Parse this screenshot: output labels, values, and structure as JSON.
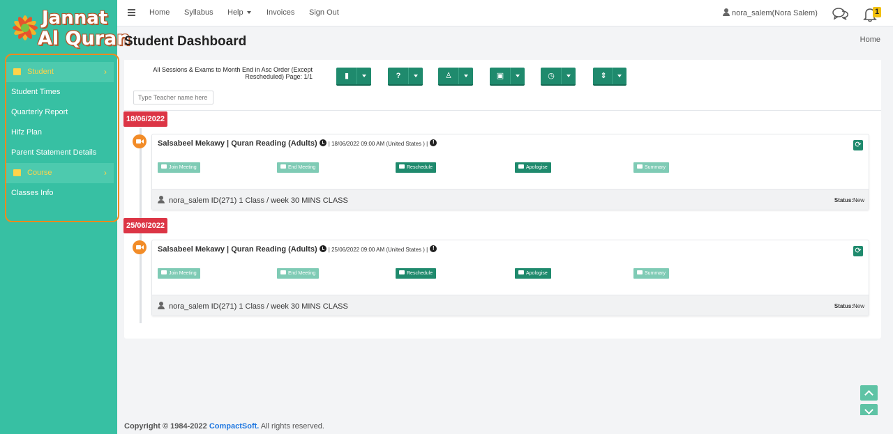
{
  "brand": {
    "line1": "Jannat",
    "line2": "Al Quran"
  },
  "sidebar": {
    "items": [
      {
        "label": "Student",
        "type": "group",
        "icon": "users-icon"
      },
      {
        "label": "Student Times",
        "type": "link"
      },
      {
        "label": "Quarterly Report",
        "type": "link"
      },
      {
        "label": "Hifz Plan",
        "type": "link"
      },
      {
        "label": "Parent Statement Details",
        "type": "link"
      },
      {
        "label": "Course",
        "type": "group",
        "icon": "book-icon"
      },
      {
        "label": "Classes Info",
        "type": "link"
      }
    ]
  },
  "topnav": {
    "links": [
      "Home",
      "Syllabus",
      "Help",
      "Invoices",
      "Sign Out"
    ],
    "user": "nora_salem(Nora Salem)",
    "notification_count": "1"
  },
  "page": {
    "title": "Student Dashboard",
    "breadcrumb": "Home"
  },
  "filters": {
    "summary": "All Sessions & Exams to Month End in Asc Order (Except Rescheduled) Page: 1/1",
    "teacher_placeholder": "Type Teacher name here",
    "toolbar_icons": [
      "book-icon",
      "question-icon",
      "user-icon",
      "calendar-icon",
      "clock-icon",
      "sort-icon"
    ]
  },
  "sessions": [
    {
      "date": "18/06/2022",
      "title": "Salsabeel Mekawy | Quran Reading (Adults)",
      "meta": "| 18/06/2022 09:00 AM (United States ) |",
      "actions": [
        "Join Meeting",
        "End Meeting",
        "Reschedule",
        "Apologise",
        "Summary"
      ],
      "footer": "nora_salem ID(271) 1 Class / week 30 MINS CLASS",
      "status_label": "Status:",
      "status_value": "New"
    },
    {
      "date": "25/06/2022",
      "title": "Salsabeel Mekawy | Quran Reading (Adults)",
      "meta": "| 25/06/2022 09:00 AM (United States ) |",
      "actions": [
        "Join Meeting",
        "End Meeting",
        "Reschedule",
        "Apologise",
        "Summary"
      ],
      "footer": "nora_salem ID(271) 1 Class / week 30 MINS CLASS",
      "status_label": "Status:",
      "status_value": "New"
    }
  ],
  "footer": {
    "prefix": "Copyright © 1984-2022",
    "brand": "CompactSoft.",
    "suffix": "All rights reserved."
  },
  "colors": {
    "sidebar": "#37c0a3",
    "accent": "#1f8a6d",
    "date_badge": "#dc3545",
    "highlight_outline": "#f08a1e"
  }
}
